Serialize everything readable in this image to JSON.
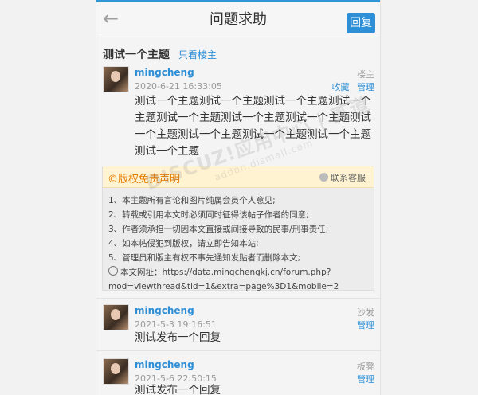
{
  "header": {
    "back_icon": "arrow-left-icon",
    "title": "问题求助",
    "reply_label": "回复"
  },
  "thread": {
    "title": "测试一个主题",
    "only_op_label": "只看楼主"
  },
  "posts": [
    {
      "author": "mingcheng",
      "date": "2020-6-21 16:33:05",
      "floor": "楼主",
      "actions": [
        "收藏",
        "管理"
      ],
      "content": "测试一个主题测试一个主题测试一个主题测试一个主题测试一个主题测试一个主题测试一个主题测试一个主题测试一个主题测试一个主题测试一个主题测试一个主题"
    },
    {
      "author": "mingcheng",
      "date": "2021-5-3 19:16:51",
      "floor": "沙发",
      "actions": [
        "管理"
      ],
      "content": "测试发布一个回复"
    },
    {
      "author": "mingcheng",
      "date": "2021-5-6 22:50:15",
      "floor": "板凳",
      "actions": [
        "管理"
      ],
      "content": "测试发布一个回复"
    }
  ],
  "notice": {
    "title": "©版权免责声明",
    "contact_label": "联系客服",
    "lines": [
      "1、本主题所有言论和图片纯属会员个人意见;",
      "2、转载或引用本文时必须同时征得该帖子作者的同意;",
      "3、作者须承担一切因本文直接或间接导致的民事/刑事责任;",
      "4、如本帖侵犯到版权，请立即告知本站;",
      "5、管理员和版主有权不事先通知发贴者而删除本文;"
    ],
    "url_label": "本文网址：https://data.mingchengkj.cn/forum.php?",
    "url_label2": "mod=viewthread&tid=1&extra=page%3D1&mobile=2"
  },
  "watermark": {
    "text": "DISCUZ!应用中心 | 贰道",
    "subtext": "addon.dismall.com"
  }
}
